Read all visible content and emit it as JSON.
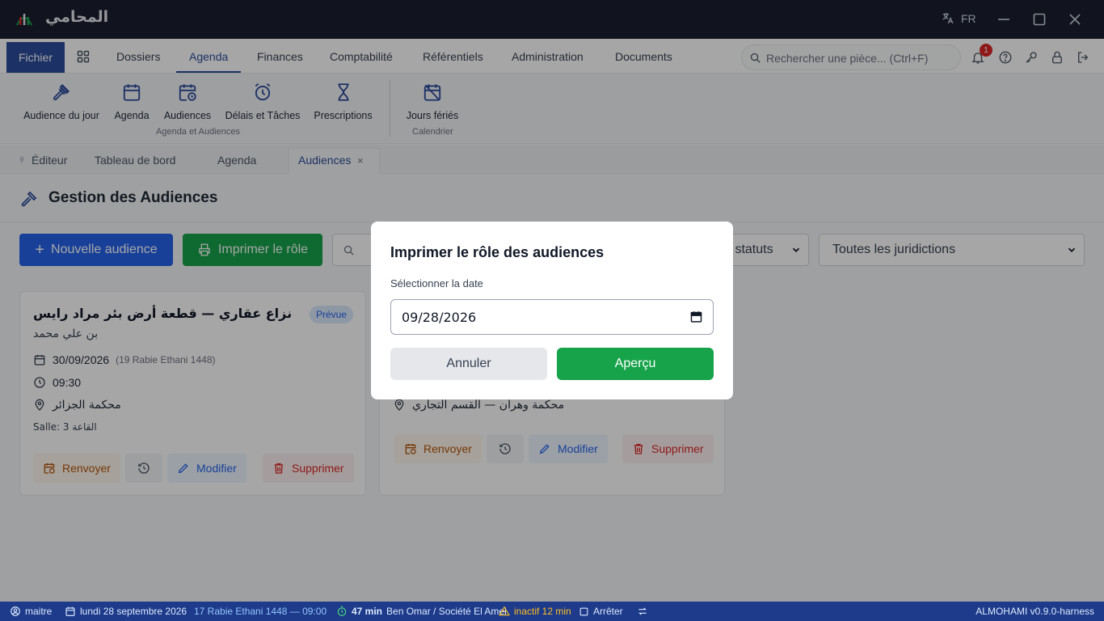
{
  "window": {
    "app_title": "المحامي",
    "language": "FR"
  },
  "menu": {
    "fichier": "Fichier",
    "items": [
      "Dossiers",
      "Agenda",
      "Finances",
      "Comptabilité",
      "Référentiels",
      "Administration",
      "Documents"
    ],
    "active": "Agenda",
    "search_placeholder": "Rechercher une pièce... (Ctrl+F)",
    "notification_count": "1"
  },
  "ribbon": {
    "buttons": [
      "Audience du jour",
      "Agenda",
      "Audiences",
      "Délais et Tâches",
      "Prescriptions",
      "Jours fériés"
    ],
    "groups": [
      "Agenda et Audiences",
      "Calendrier"
    ]
  },
  "tabs": {
    "items": [
      "Éditeur",
      "Tableau de bord",
      "Agenda",
      "Audiences"
    ],
    "active": "Audiences",
    "close_glyph": "×"
  },
  "page": {
    "title": "Gestion des Audiences",
    "new_button": "Nouvelle audience",
    "print_button": "Imprimer le rôle",
    "status_filter": "s statuts",
    "jurisdiction_filter": "Toutes les juridictions"
  },
  "cards": [
    {
      "title": "نزاع عقاري — قطعة أرض بئر مراد رايس",
      "badge": "Prévue",
      "client": "بن علي محمد",
      "date": "30/09/2026",
      "hijri": "(19 Rabie Ethani 1448)",
      "time": "09:30",
      "court": "محكمة الجزائر",
      "room": "Salle: القاعة 3",
      "actions": [
        "Renvoyer",
        "Modifier",
        "Supprimer"
      ]
    },
    {
      "court": "محكمة وهران — القسم التجاري",
      "actions": [
        "Renvoyer",
        "Modifier",
        "Supprimer"
      ]
    }
  ],
  "dialog": {
    "title": "Imprimer le rôle des audiences",
    "label": "Sélectionner la date",
    "date_value": "09/28/2026",
    "cancel": "Annuler",
    "confirm": "Aperçu"
  },
  "status_bar": {
    "user": "maitre",
    "date": "lundi 28 septembre 2026",
    "hijri": "17 Rabie Ethani 1448 — 09:00",
    "timer": "47 min",
    "client": "Ben Omar / Société El Amel",
    "inactive": "inactif 12 min",
    "stop": "Arrêter",
    "version": "ALMOHAMI v0.9.0-harness"
  },
  "colors": {
    "primary": "#2563eb",
    "brand": "#2b4c9b",
    "success": "#16a34a",
    "danger": "#dc2626",
    "titlebar": "#1b1f2e",
    "statusbar": "#1e3a8a"
  }
}
